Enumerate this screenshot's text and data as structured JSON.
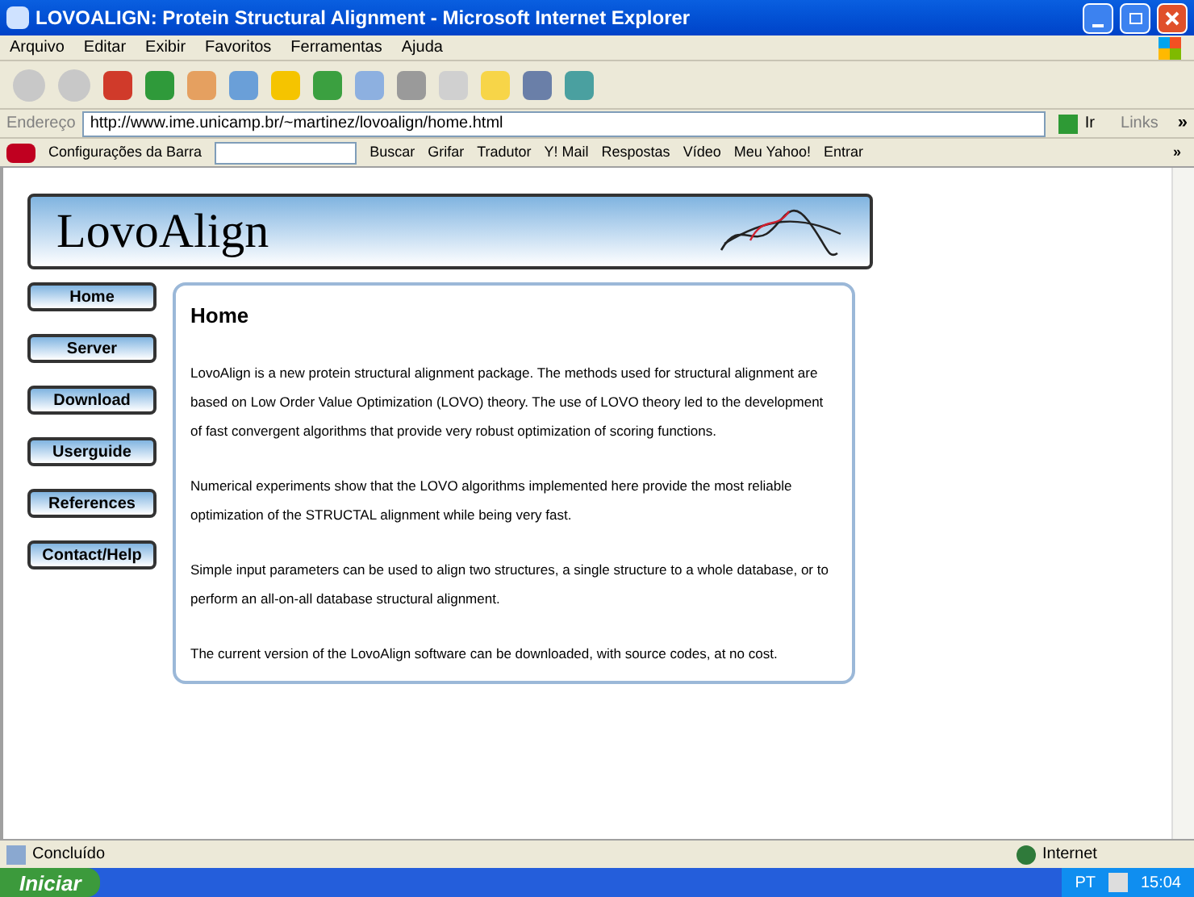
{
  "window": {
    "title": "LOVOALIGN: Protein Structural Alignment - Microsoft Internet Explorer"
  },
  "menu": [
    "Arquivo",
    "Editar",
    "Exibir",
    "Favoritos",
    "Ferramentas",
    "Ajuda"
  ],
  "address_bar": {
    "label": "Endereço",
    "value": "http://www.ime.unicamp.br/~martinez/lovoalign/home.html",
    "go": "Ir",
    "links": "Links",
    "more": "»"
  },
  "yahoo_bar": {
    "settings": "Configurações da Barra",
    "search": "Buscar",
    "items": [
      "Grifar",
      "Tradutor",
      "Y! Mail",
      "Respostas",
      "Vídeo",
      "Meu Yahoo!",
      "Entrar"
    ],
    "more": "»"
  },
  "page": {
    "logo": "LovoAlign",
    "nav": [
      {
        "label": "Home"
      },
      {
        "label": "Server"
      },
      {
        "label": "Download"
      },
      {
        "label": "Userguide"
      },
      {
        "label": "References"
      },
      {
        "label": "Contact/Help"
      }
    ],
    "heading": "Home",
    "paragraphs": [
      "LovoAlign is a new protein structural alignment package. The methods used for structural alignment are based on Low Order Value Optimization (LOVO) theory. The use of LOVO theory led to the development of fast convergent algorithms that provide very robust optimization of scoring functions.",
      "Numerical experiments show that the LOVO algorithms implemented here provide the most reliable optimization of the STRUCTAL alignment while being very fast.",
      "Simple input parameters can be used to align two structures, a single structure to a whole database, or to perform an all-on-all database structural alignment.",
      "The current version of the LovoAlign software can be downloaded, with source codes, at no cost."
    ]
  },
  "status_bar": {
    "text": "Concluído",
    "zone": "Internet"
  },
  "taskbar": {
    "start": "Iniciar",
    "language": "PT",
    "clock": "15:04"
  }
}
